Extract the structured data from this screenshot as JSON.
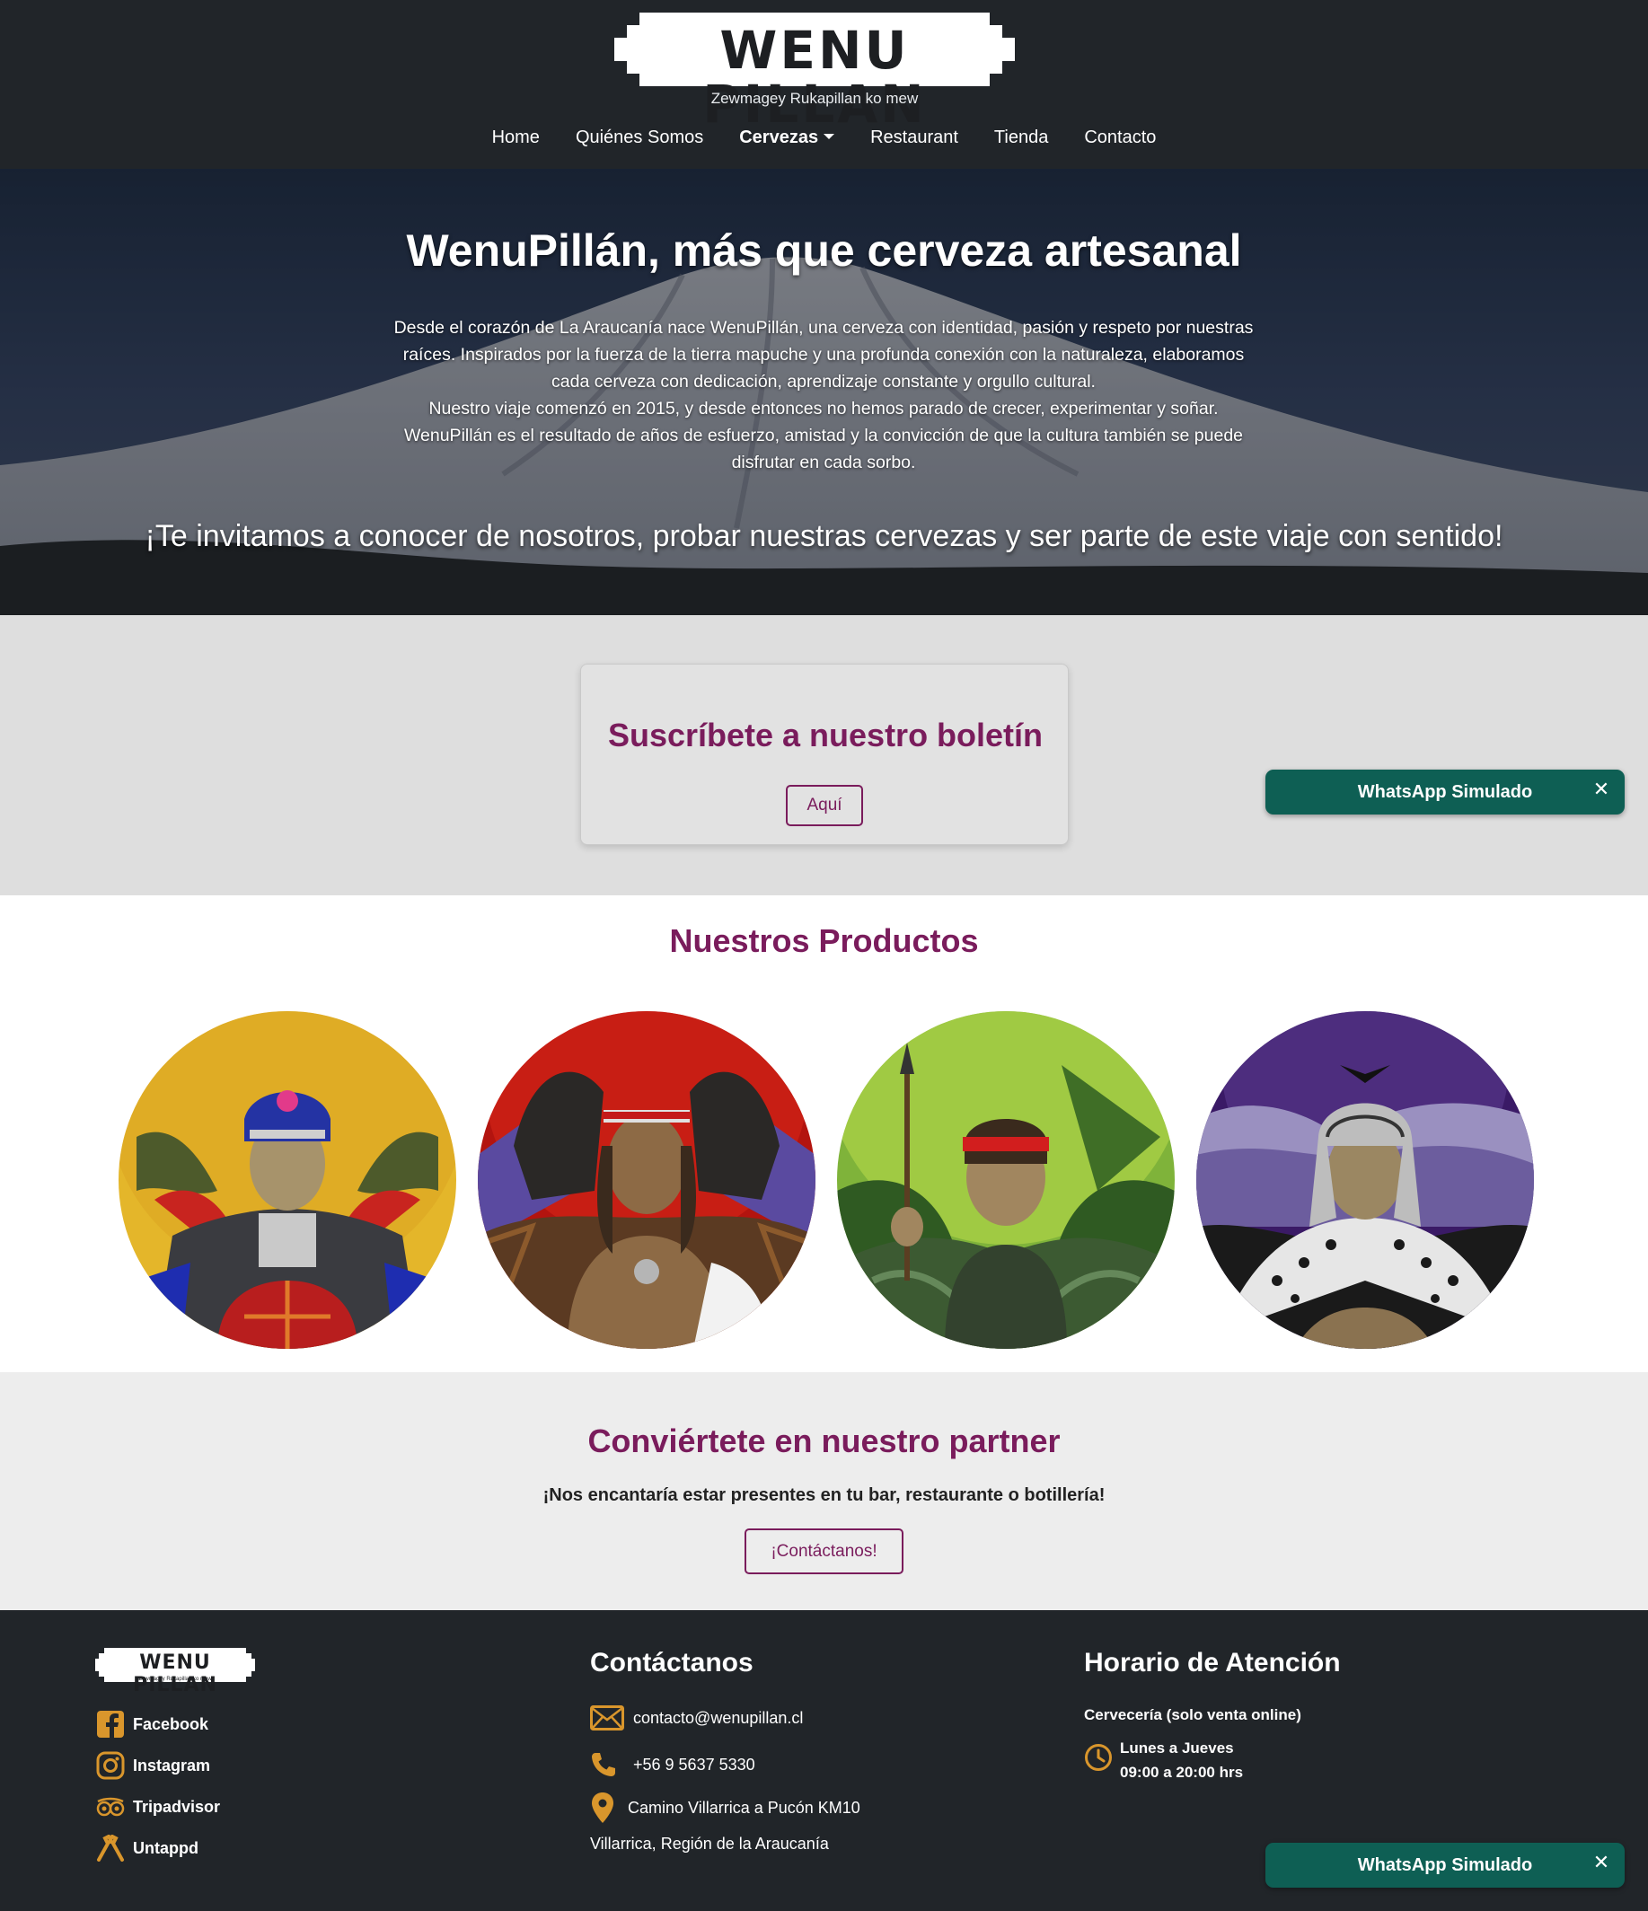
{
  "brand": {
    "name": "WENU PILLAN",
    "tagline": "Zewmagey Rukapillan ko mew"
  },
  "nav": {
    "items": [
      {
        "label": "Home"
      },
      {
        "label": "Quiénes Somos"
      },
      {
        "label": "Cervezas"
      },
      {
        "label": "Restaurant"
      },
      {
        "label": "Tienda"
      },
      {
        "label": "Contacto"
      }
    ],
    "active": "Cervezas"
  },
  "hero": {
    "title": "WenuPillán, más que cerveza artesanal",
    "lines": [
      "Desde el corazón de La Araucanía nace WenuPillán, una cerveza con identidad, pasión y respeto por nuestras",
      "raíces. Inspirados por la fuerza de la tierra mapuche y una profunda conexión con la naturaleza, elaboramos",
      "cada cerveza con dedicación, aprendizaje constante y orgullo cultural.",
      "Nuestro viaje comenzó en 2015, y desde entonces no hemos parado de crecer, experimentar y soñar.",
      "WenuPillán es el resultado de años de esfuerzo, amistad y la convicción de que la cultura también se puede",
      "disfrutar en cada sorbo."
    ],
    "invite": "¡Te invitamos a conocer de nosotros, probar nuestras cervezas y ser parte de este viaje con sentido!"
  },
  "newsletter": {
    "title": "Suscríbete a nuestro boletín",
    "button": "Aquí"
  },
  "whatsapp": {
    "label": "WhatsApp Simulado",
    "close": "✕"
  },
  "products": {
    "title": "Nuestros Productos",
    "items": [
      {
        "icon": "woman-with-headdress-illustration"
      },
      {
        "icon": "warrior-with-horses-illustration"
      },
      {
        "icon": "warrior-with-spear-illustration"
      },
      {
        "icon": "elder-with-leopard-cape-illustration"
      }
    ]
  },
  "partner": {
    "title": "Conviértete en nuestro partner",
    "subtitle": "¡Nos encantaría estar presentes en tu bar, restaurante o botillería!",
    "button": "¡Contáctanos!"
  },
  "footer": {
    "social": [
      {
        "label": "Facebook",
        "icon": "facebook-icon"
      },
      {
        "label": "Instagram",
        "icon": "instagram-icon"
      },
      {
        "label": "Tripadvisor",
        "icon": "tripadvisor-icon"
      },
      {
        "label": "Untappd",
        "icon": "untappd-icon"
      }
    ],
    "contact": {
      "title": "Contáctanos",
      "email": "contacto@wenupillan.cl",
      "phone": "+56 9 5637 5330",
      "address1": "Camino Villarrica a Pucón KM10",
      "address2": "Villarrica, Región de la Araucanía"
    },
    "hours": {
      "title": "Horario de Atención",
      "subtitle": "Cervecería (solo venta online)",
      "days": "Lunes a Jueves",
      "time": "09:00 a 20:00 hrs"
    }
  },
  "colors": {
    "accent": "#7a1c5c",
    "dark": "#212529",
    "whatsapp": "#0e5f54",
    "icon_gold": "#d9962c"
  }
}
